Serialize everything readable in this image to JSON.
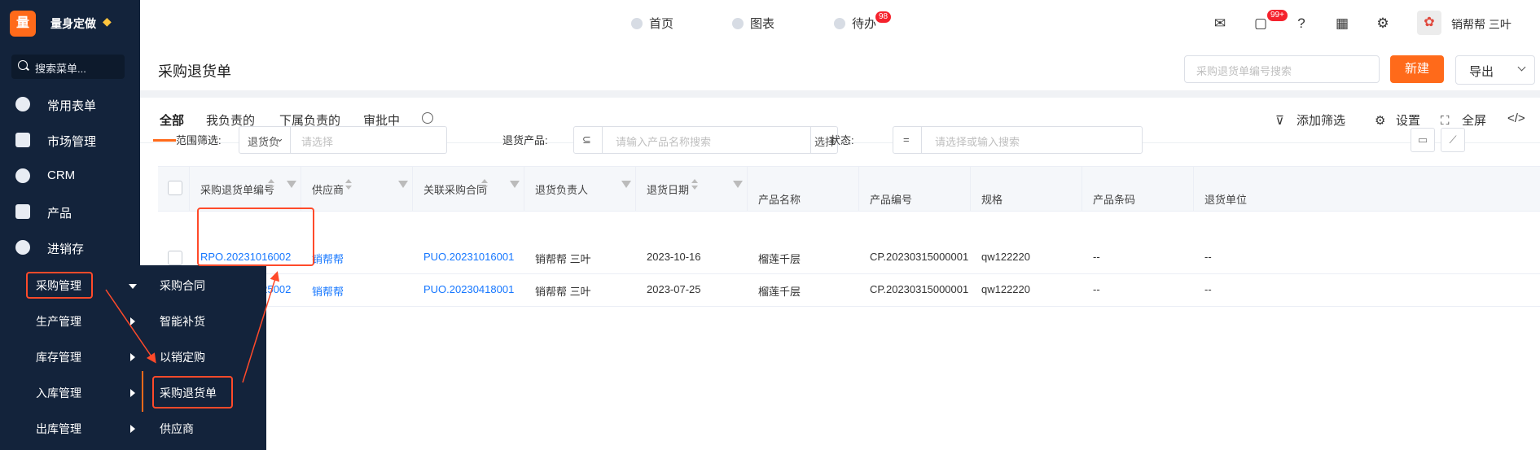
{
  "sidebar": {
    "logo_char": "量",
    "brand": "量身定做",
    "search_placeholder": "搜索菜单...",
    "items": [
      {
        "label": "常用表单",
        "icon": "star-icon"
      },
      {
        "label": "市场管理",
        "icon": "clipboard-icon"
      },
      {
        "label": "CRM",
        "icon": "pie-chart-icon"
      },
      {
        "label": "产品",
        "icon": "blocks-icon"
      },
      {
        "label": "进销存",
        "icon": "compass-icon"
      }
    ],
    "flyout_left": [
      "采购管理",
      "生产管理",
      "库存管理",
      "入库管理",
      "出库管理"
    ],
    "flyout_right": [
      "采购合同",
      "智能补货",
      "以销定购",
      "采购退货单",
      "供应商"
    ]
  },
  "header": {
    "tabs": [
      {
        "label": "首页",
        "icon": "home-icon"
      },
      {
        "label": "图表",
        "icon": "chart-icon"
      },
      {
        "label": "待办",
        "icon": "calendar-icon",
        "badge": "98"
      }
    ],
    "message_badge": "99+",
    "user_name": "销帮帮 三叶"
  },
  "page": {
    "title": "采购退货单",
    "search_placeholder": "采购退货单编号搜索",
    "new_label": "新建",
    "export_label": "导出"
  },
  "tabs": [
    "全部",
    "我负责的",
    "下属负责的",
    "审批中"
  ],
  "tools": [
    "添加筛选",
    "设置",
    "全屏"
  ],
  "filters": {
    "range_label": "范围筛选:",
    "range_select": "退货负",
    "range_placeholder": "请选择",
    "product_label": "退货产品:",
    "product_placeholder": "请输入产品名称搜索",
    "product_btn": "选择",
    "status_label": "状态:",
    "status_placeholder": "请选择或输入搜索"
  },
  "table": {
    "columns": [
      "采购退货单编号",
      "供应商",
      "关联采购合同",
      "退货负责人",
      "退货日期",
      "产品名称",
      "产品编号",
      "规格",
      "产品条码",
      "退货单位"
    ],
    "rows": [
      [
        "RPO.20231016002",
        "销帮帮",
        "PUO.20231016001",
        "销帮帮 三叶",
        "2023-10-16",
        "榴莲千层",
        "CP.20230315000001",
        "qw122220",
        "--",
        "--"
      ],
      [
        "RPO.20230725002",
        "销帮帮",
        "PUO.20230418001",
        "销帮帮 三叶",
        "2023-07-25",
        "榴莲千层",
        "CP.20230315000001",
        "qw122220",
        "--",
        "--"
      ]
    ]
  },
  "colors": {
    "accent": "#ff6a1a",
    "sidebar": "#13233b",
    "link": "#1677ff",
    "highlight": "#ff4a2a"
  }
}
